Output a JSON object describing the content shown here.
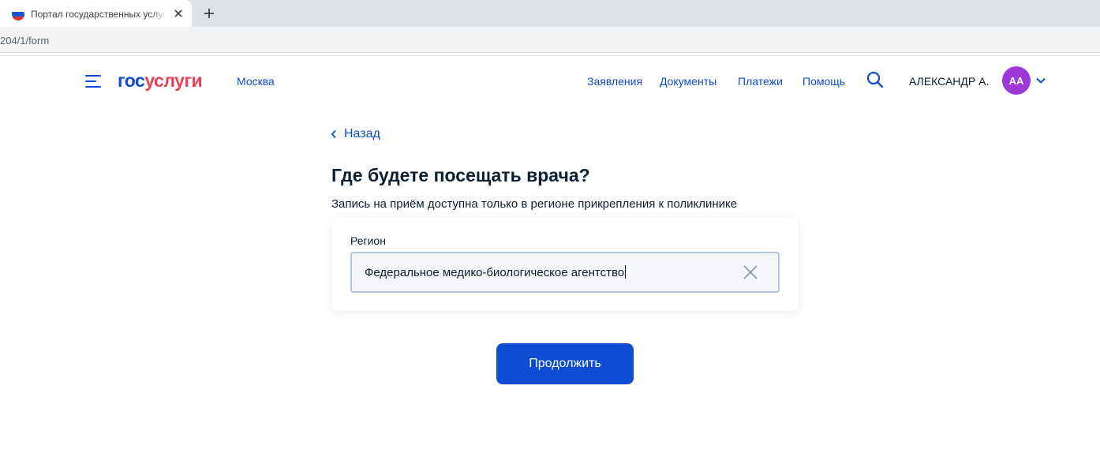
{
  "browser": {
    "tab_title": "Портал государственных услуг Российской Федерации",
    "url": "204/1/form"
  },
  "header": {
    "logo_gos": "гос",
    "logo_uslugi": "услуги",
    "region": "Москва",
    "nav": [
      "Заявления",
      "Документы",
      "Платежи",
      "Помощь"
    ],
    "user_name": "АЛЕКСАНДР А.",
    "avatar_initials": "АА"
  },
  "page": {
    "back_label": "Назад",
    "title": "Где будете посещать врача?",
    "subtitle": "Запись на приём доступна только в регионе прикрепления к поликлинике",
    "field_label": "Регион",
    "field_value": "Федеральное медико-биологическое агентство",
    "submit_label": "Продолжить"
  },
  "colors": {
    "primary": "#0d4cd3",
    "logo_red": "#ee3f58",
    "text": "#0b1f33",
    "avatar": "#9e39d8"
  }
}
